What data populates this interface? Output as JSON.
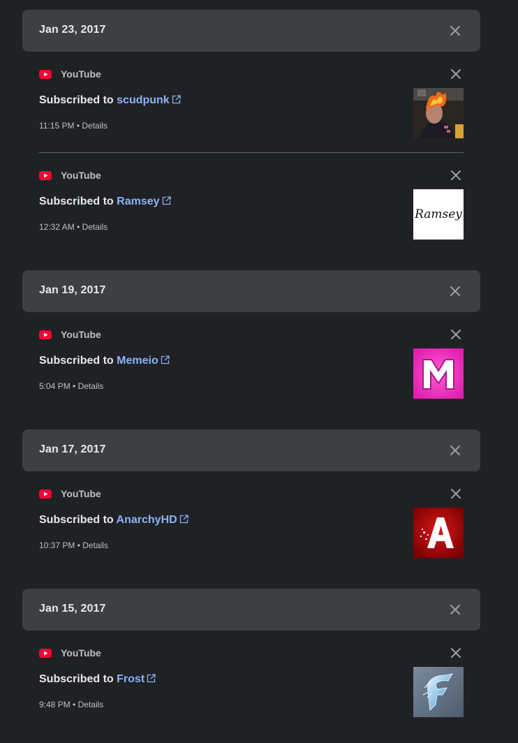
{
  "groups": [
    {
      "date": "Jan 23, 2017",
      "items": [
        {
          "product": "YouTube",
          "prefix": "Subscribed to",
          "channel": "scudpunk",
          "time": "11:15 PM",
          "details": "Details",
          "thumb": "scudpunk-avatar"
        },
        {
          "product": "YouTube",
          "prefix": "Subscribed to",
          "channel": "Ramsey",
          "time": "12:32 AM",
          "details": "Details",
          "thumb": "ramsey-avatar"
        }
      ]
    },
    {
      "date": "Jan 19, 2017",
      "items": [
        {
          "product": "YouTube",
          "prefix": "Subscribed to",
          "channel": "Memeio",
          "time": "5:04 PM",
          "details": "Details",
          "thumb": "memeio-avatar"
        }
      ]
    },
    {
      "date": "Jan 17, 2017",
      "items": [
        {
          "product": "YouTube",
          "prefix": "Subscribed to",
          "channel": "AnarchyHD",
          "time": "10:37 PM",
          "details": "Details",
          "thumb": "anarchyhd-avatar"
        }
      ]
    },
    {
      "date": "Jan 15, 2017",
      "items": [
        {
          "product": "YouTube",
          "prefix": "Subscribed to",
          "channel": "Frost",
          "time": "9:48 PM",
          "details": "Details",
          "thumb": "frost-avatar"
        }
      ]
    }
  ],
  "separator": "•",
  "thumbnails": {
    "ramsey-avatar": {
      "text": "Ramsey"
    }
  },
  "icons": {
    "close": "close-icon",
    "youtube": "youtube-logo-icon",
    "external": "external-link-icon"
  },
  "colors": {
    "background": "#202124",
    "header_bg": "#3c4043",
    "link": "#8ab4f8",
    "text": "#e8eaed",
    "secondary_text": "#bdc1c6",
    "youtube_red": "#ff0033"
  }
}
